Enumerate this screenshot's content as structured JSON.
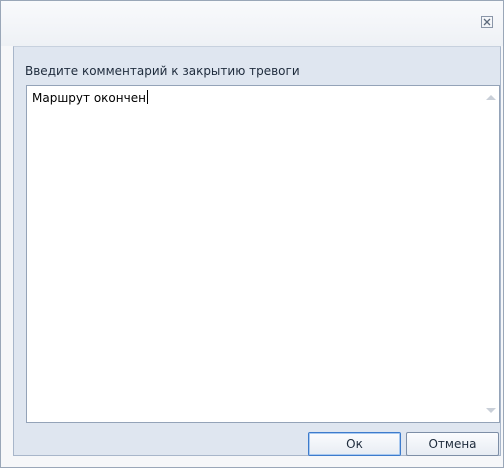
{
  "dialog": {
    "prompt_label": "Введите комментарий к закрытию тревоги",
    "comment_value": "Маршрут окончен",
    "ok_label": "Ок",
    "cancel_label": "Отмена"
  },
  "icons": {
    "close": "close-icon",
    "scroll_up": "scroll-up-arrow-icon",
    "scroll_down": "scroll-down-arrow-icon"
  },
  "colors": {
    "panel_background": "#dfe6f0",
    "default_button_border": "#3d7bcc"
  }
}
